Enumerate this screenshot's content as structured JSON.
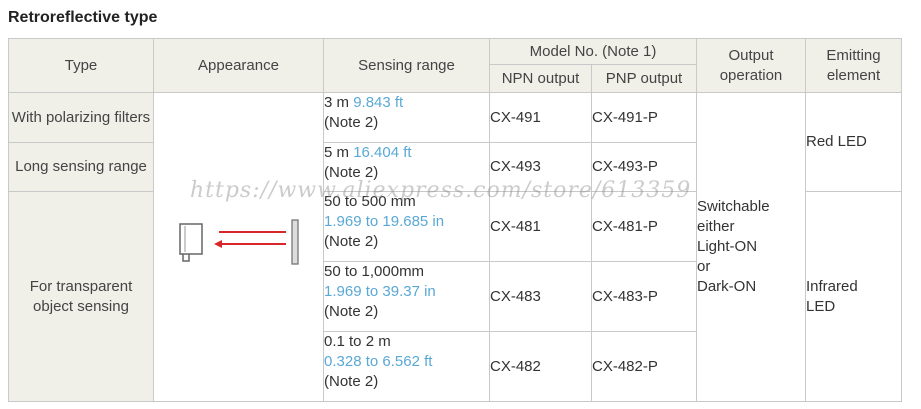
{
  "title": "Retroreflective type",
  "headers": {
    "type": "Type",
    "appearance": "Appearance",
    "sensing_range": "Sensing range",
    "model_no": "Model No. (Note 1)",
    "npn": "NPN output",
    "pnp": "PNP output",
    "output_operation": "Output operation",
    "emitting_element": "Emitting element"
  },
  "types": {
    "polarizing": "With polarizing filters",
    "long": "Long sensing range",
    "transparent": "For transparent object sensing"
  },
  "rows": [
    {
      "range": "3 m",
      "range_alt": "9.843 ft",
      "note": "(Note 2)",
      "npn": "CX-491",
      "pnp": "CX-491-P"
    },
    {
      "range": "5 m",
      "range_alt": "16.404 ft",
      "note": "(Note 2)",
      "npn": "CX-493",
      "pnp": "CX-493-P"
    },
    {
      "range": "50 to 500 mm",
      "range_alt": "1.969 to 19.685 in",
      "note": "(Note 2)",
      "npn": "CX-481",
      "pnp": "CX-481-P"
    },
    {
      "range": "50 to 1,000mm",
      "range_alt": "1.969 to 39.37 in",
      "note": "(Note 2)",
      "npn": "CX-483",
      "pnp": "CX-483-P"
    },
    {
      "range": "0.1 to 2 m",
      "range_alt": "0.328 to 6.562 ft",
      "note": "(Note 2)",
      "npn": "CX-482",
      "pnp": "CX-482-P"
    }
  ],
  "output_operation": [
    "Switchable",
    "either",
    "Light-ON",
    "or",
    "Dark-ON"
  ],
  "emitting": {
    "red": "Red LED",
    "infrared": [
      "Infrared",
      "LED"
    ]
  },
  "watermark": "https://www.aliexpress.com/store/613359",
  "colors": {
    "header_bg": "#f0efe8",
    "border": "#c9c9c9",
    "link_blue": "#5aa8d6",
    "beam_red": "#d9262b"
  }
}
